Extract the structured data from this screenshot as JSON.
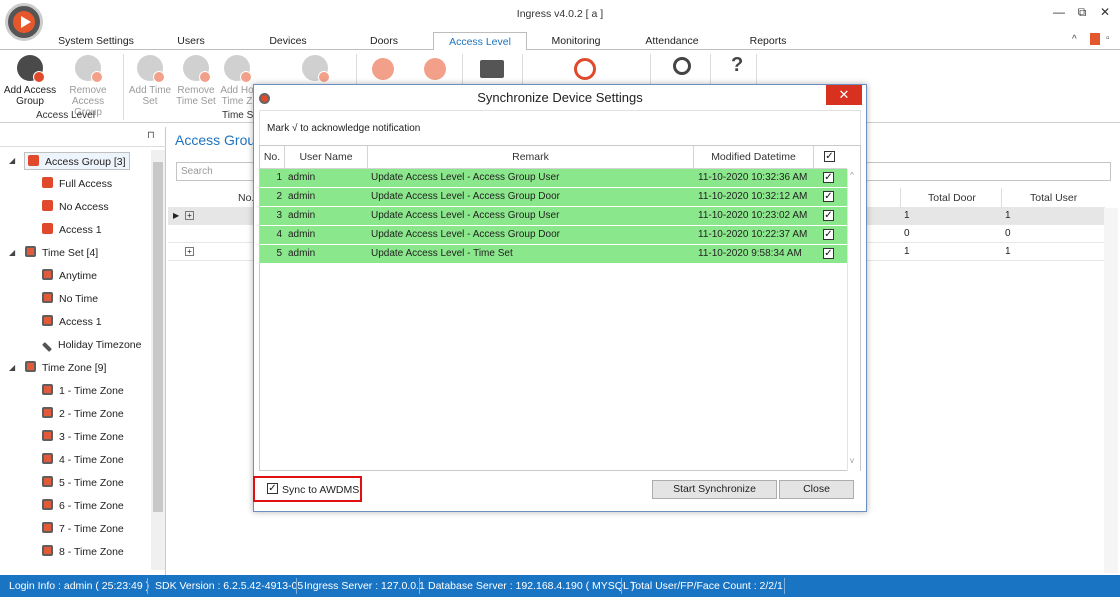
{
  "window": {
    "title": "Ingress v4.0.2 [ a ]",
    "minimize": "—",
    "restore": "⧉",
    "close": "✕"
  },
  "tabs": [
    {
      "label": "System Settings",
      "active": false
    },
    {
      "label": "Users",
      "active": false
    },
    {
      "label": "Devices",
      "active": false
    },
    {
      "label": "Doors",
      "active": false
    },
    {
      "label": "Access Level",
      "active": true
    },
    {
      "label": "Monitoring",
      "active": false
    },
    {
      "label": "Attendance",
      "active": false
    },
    {
      "label": "Reports",
      "active": false
    }
  ],
  "ribbon": {
    "add_access_group": "Add Access Group",
    "remove_access_group": "Remove Access Group",
    "group_access_level": "Access Level",
    "add_time_set": "Add Time Set",
    "remove_time_set": "Remove Time Set",
    "add_holiday_timezone": "Add Ho Time Z",
    "group_time_set": "Time Se",
    "help": "?"
  },
  "tree": {
    "pin": "⊓",
    "access_group": "Access Group [3]",
    "access_group_items": [
      "Full Access",
      "No Access",
      "Access 1"
    ],
    "time_set": "Time Set [4]",
    "time_set_items": [
      "Anytime",
      "No Time",
      "Access 1",
      "Holiday Timezone"
    ],
    "time_zone": "Time Zone [9]",
    "time_zone_items": [
      "1 - Time Zone",
      "2 - Time Zone",
      "3 - Time Zone",
      "4 - Time Zone",
      "5 - Time Zone",
      "6 - Time Zone",
      "7 - Time Zone",
      "8 - Time Zone"
    ]
  },
  "main": {
    "title": "Access Group",
    "search_placeholder": "Search",
    "columns": {
      "no": "No.",
      "total_door": "Total Door",
      "total_user": "Total User"
    },
    "rows": [
      {
        "total_door": "1",
        "total_user": "1"
      },
      {
        "total_door": "0",
        "total_user": "0"
      },
      {
        "total_door": "1",
        "total_user": "1"
      }
    ]
  },
  "dialog": {
    "title": "Synchronize Device Settings",
    "close": "✕",
    "note": "Mark √ to acknowledge notification",
    "columns": {
      "no": "No.",
      "user_name": "User Name",
      "remark": "Remark",
      "modified": "Modified Datetime",
      "check": "✓"
    },
    "rows": [
      {
        "no": "1",
        "user": "admin",
        "remark": "Update Access Level - Access Group User",
        "datetime": "11-10-2020 10:32:36 AM",
        "checked": "✓"
      },
      {
        "no": "2",
        "user": "admin",
        "remark": "Update Access Level - Access Group Door",
        "datetime": "11-10-2020 10:32:12 AM",
        "checked": "✓"
      },
      {
        "no": "3",
        "user": "admin",
        "remark": "Update Access Level - Access Group User",
        "datetime": "11-10-2020 10:23:02 AM",
        "checked": "✓"
      },
      {
        "no": "4",
        "user": "admin",
        "remark": "Update Access Level - Access Group Door",
        "datetime": "11-10-2020 10:22:37 AM",
        "checked": "✓"
      },
      {
        "no": "5",
        "user": "admin",
        "remark": "Update Access Level - Time Set",
        "datetime": "11-10-2020 9:58:34 AM",
        "checked": "✓"
      }
    ],
    "sync_label": "Sync to AWDMS",
    "sync_checked": "✓",
    "start_button": "Start Synchronize",
    "close_button": "Close"
  },
  "status": {
    "login": "Login Info : admin ( 25:23:49 )",
    "sdk": "SDK Version : 6.2.5.42-4913-05",
    "ingress_server": "Ingress Server : 127.0.0.1",
    "database_server": "Database Server : 192.168.4.190 ( MYSQL )",
    "total": "Total User/FP/Face Count : 2/2/1"
  },
  "colors": {
    "accent": "#1e73be",
    "status_bar": "#1a74c4",
    "row_green": "#8be78b",
    "close_red": "#d9311f",
    "highlight_red": "#e01010"
  }
}
